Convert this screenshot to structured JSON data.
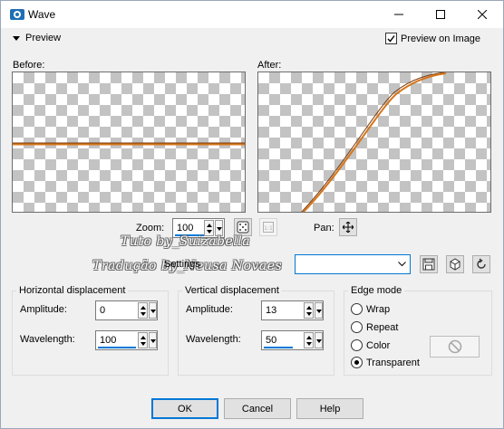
{
  "window": {
    "title": "Wave",
    "minimize_glyph": "—",
    "maximize_glyph": "☐",
    "close_glyph": "✕"
  },
  "preview": {
    "toggle_label": "Preview",
    "preview_on_image_label": "Preview on Image",
    "preview_on_image_checked": true
  },
  "before_label": "Before:",
  "after_label": "After:",
  "zoom": {
    "label": "Zoom:",
    "value": "100"
  },
  "pan": {
    "label": "Pan:"
  },
  "watermark": {
    "line1": "Tuto by_Suizabella",
    "line2": "Tradução by_Neusa Novaes"
  },
  "settings": {
    "label": "Settings",
    "value": ""
  },
  "horizontal": {
    "title": "Horizontal displacement",
    "amplitude_label": "Amplitude:",
    "amplitude_value": "0",
    "wavelength_label": "Wavelength:",
    "wavelength_value": "100"
  },
  "vertical": {
    "title": "Vertical displacement",
    "amplitude_label": "Amplitude:",
    "amplitude_value": "13",
    "wavelength_label": "Wavelength:",
    "wavelength_value": "50"
  },
  "edge_mode": {
    "title": "Edge mode",
    "options": [
      "Wrap",
      "Repeat",
      "Color",
      "Transparent"
    ],
    "selected": "Transparent"
  },
  "buttons": {
    "ok": "OK",
    "cancel": "Cancel",
    "help": "Help"
  },
  "colors": {
    "accent": "#0078d7",
    "line": "#c8650f"
  },
  "icons": [
    "wave-app-icon",
    "eye-icon",
    "dice-icon",
    "save-icon",
    "delete-icon",
    "reset-icon",
    "move-icon",
    "no-icon"
  ]
}
